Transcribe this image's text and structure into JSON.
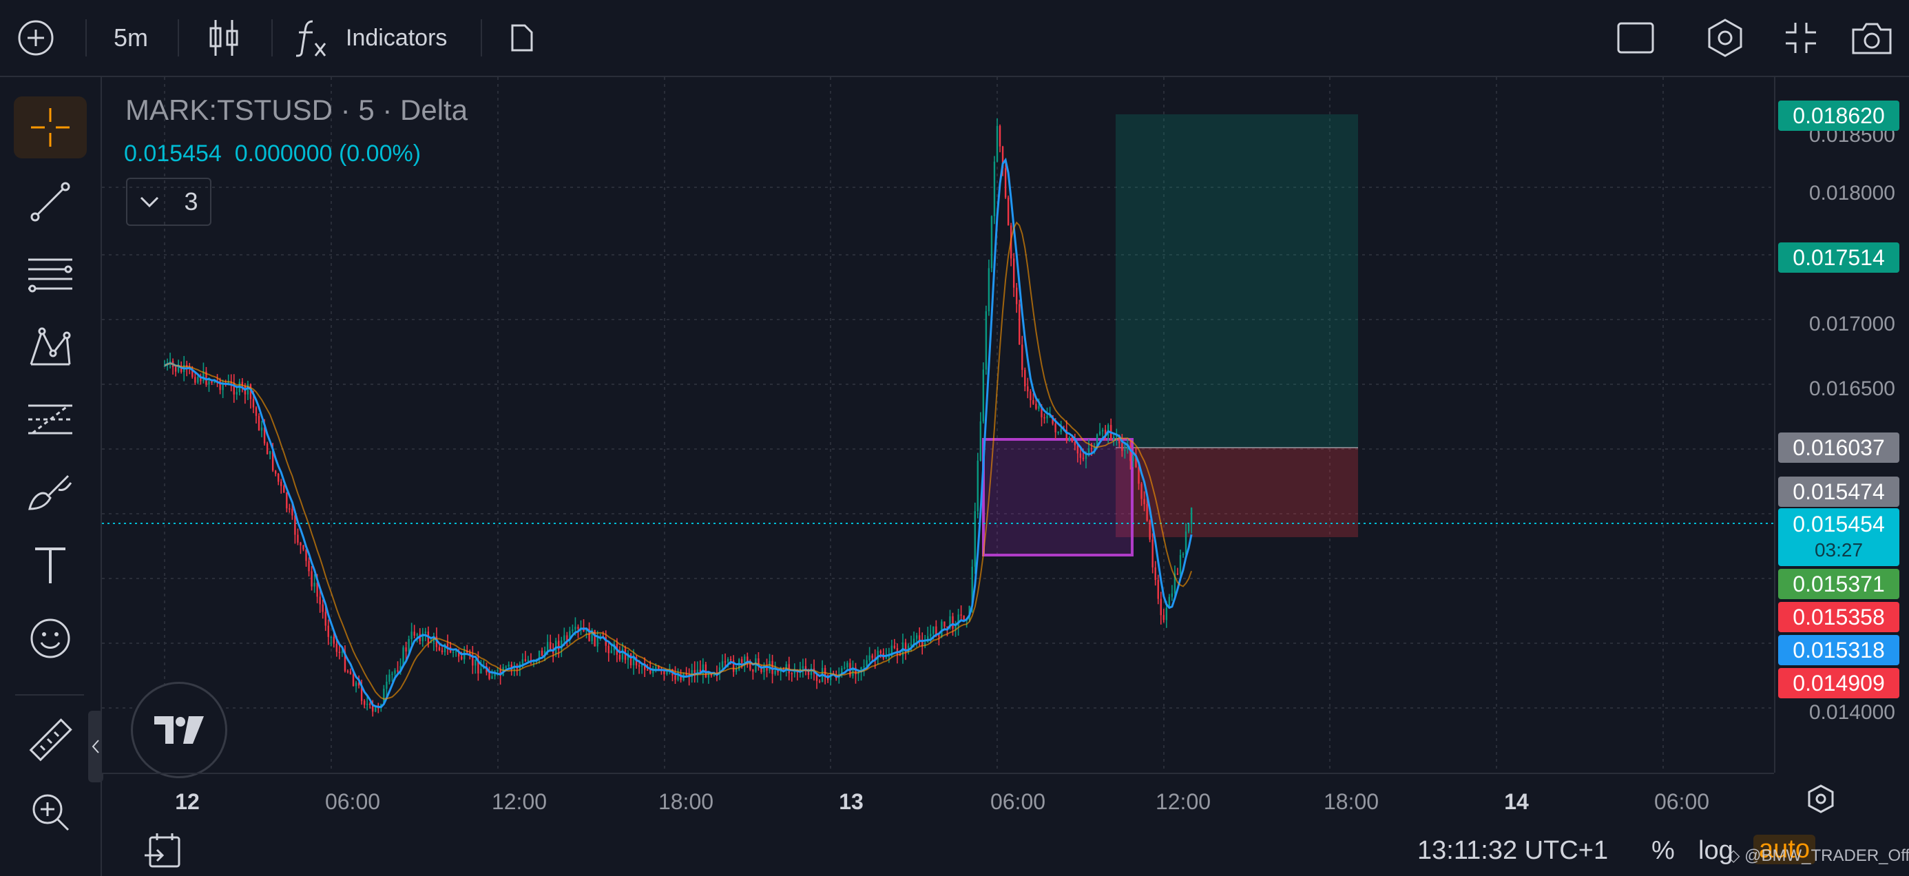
{
  "toolbar": {
    "interval": "5m",
    "indicators_label": "Indicators"
  },
  "legend": {
    "symbol": "MARK:TSTUSD · 5 · Delta",
    "last": "0.015454",
    "change": "0.000000 (0.00%)",
    "indicator_count": "3"
  },
  "price_axis": {
    "labels": [
      "0.018500",
      "0.018000",
      "0.017000",
      "0.016500",
      "0.014000"
    ],
    "tags": [
      {
        "value": "0.018620",
        "color": "#089981"
      },
      {
        "value": "0.017514",
        "color": "#089981"
      },
      {
        "value": "0.016037",
        "color": "#787b86"
      },
      {
        "value": "0.015474",
        "color": "#787b86"
      },
      {
        "value": "0.015371",
        "color": "#43a047"
      },
      {
        "value": "0.015358",
        "color": "#f23645"
      },
      {
        "value": "0.015318",
        "color": "#2196f3"
      },
      {
        "value": "0.014909",
        "color": "#f23645"
      }
    ],
    "current": {
      "value": "0.015454",
      "countdown": "03:27",
      "color": "#00bcd4"
    }
  },
  "time_axis": {
    "labels": [
      {
        "text": "12",
        "bold": true
      },
      {
        "text": "06:00",
        "bold": false
      },
      {
        "text": "12:00",
        "bold": false
      },
      {
        "text": "18:00",
        "bold": false
      },
      {
        "text": "13",
        "bold": true
      },
      {
        "text": "06:00",
        "bold": false
      },
      {
        "text": "12:00",
        "bold": false
      },
      {
        "text": "18:00",
        "bold": false
      },
      {
        "text": "14",
        "bold": true
      },
      {
        "text": "06:00",
        "bold": false
      }
    ]
  },
  "bottom": {
    "clock": "13:11:32 UTC+1",
    "percent": "%",
    "log": "log",
    "auto": "auto",
    "watermark": "@BMW_TRADER_Official"
  },
  "colors": {
    "up": "#089981",
    "down": "#f23645",
    "ma": "#2196f3",
    "accent": "#ff9800",
    "box": "#9c27b0"
  },
  "chart_data": {
    "type": "line",
    "series": [
      {
        "x": [
          "12 00:00",
          "12 03:00",
          "12 06:00",
          "12 07:30",
          "12 09:00",
          "12 12:00",
          "12 15:00",
          "12 18:00",
          "12 21:00",
          "13 00:00",
          "13 03:00",
          "13 05:00",
          "13 06:00",
          "13 07:00",
          "13 09:00",
          "13 10:00",
          "13 11:00",
          "13 12:00",
          "13 13:00"
        ],
        "y": [
          0.0166,
          0.0164,
          0.0145,
          0.0139,
          0.01455,
          0.0142,
          0.01455,
          0.0142,
          0.0143,
          0.0142,
          0.01445,
          0.0147,
          0.0185,
          0.0164,
          0.0159,
          0.0161,
          0.01585,
          0.0146,
          0.01545
        ]
      }
    ],
    "ylim": [
      0.0138,
      0.0188
    ],
    "grid": true
  }
}
